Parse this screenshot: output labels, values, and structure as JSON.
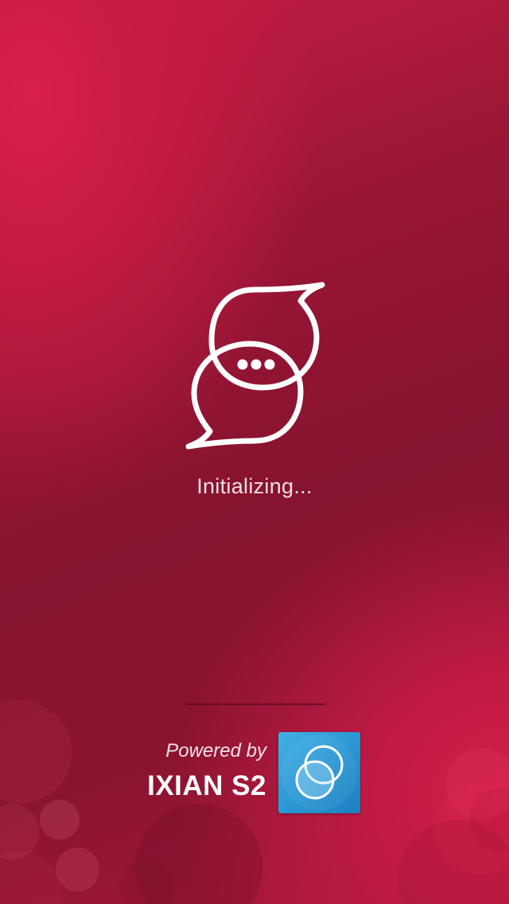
{
  "splash": {
    "status_text": "Initializing...",
    "app_logo_icon": "overlapping-chat-bubbles-icon"
  },
  "footer": {
    "powered_by_label": "Powered by",
    "brand_name": "IXIAN S2",
    "brand_logo_icon": "overlapping-circles-icon"
  },
  "colors": {
    "background_primary": "#8a1430",
    "background_highlight": "#d81f4b",
    "logo_stroke": "#ffffff",
    "brand_tile": "#2a95d2"
  }
}
